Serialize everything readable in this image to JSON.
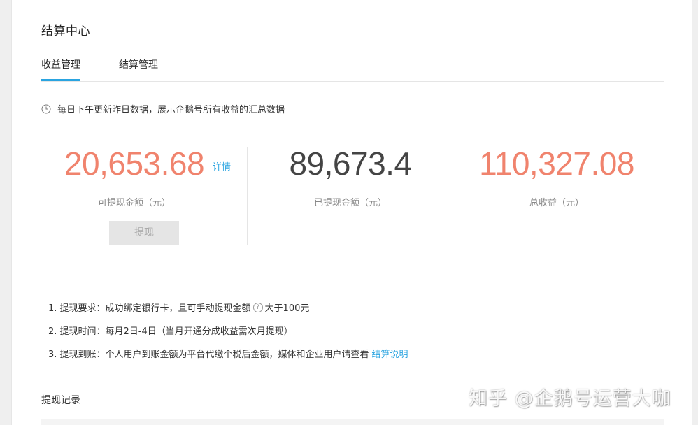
{
  "page_title": "结算中心",
  "tabs": [
    {
      "label": "收益管理",
      "active": true
    },
    {
      "label": "结算管理",
      "active": false
    }
  ],
  "notice": "每日下午更新昨日数据，展示企鹅号所有收益的汇总数据",
  "stats": {
    "withdrawable": {
      "value": "20,653.68",
      "label": "可提现金额（元）",
      "detail_link": "详情"
    },
    "withdrawn": {
      "value": "89,673.4",
      "label": "已提现金额（元）"
    },
    "total": {
      "value": "110,327.08",
      "label": "总收益（元）"
    }
  },
  "withdraw_button": "提现",
  "rules": {
    "r1_prefix": "1. 提现要求：成功绑定银行卡，且可手动提现金额",
    "r1_help": "?",
    "r1_suffix": "大于100元",
    "r2": "2. 提现时间：每月2日-4日（当月开通分成收益需次月提现）",
    "r3_text": "3. 提现到账：个人用户到账金额为平台代缴个税后金额，媒体和企业用户请查看",
    "r3_link": "结算说明"
  },
  "records_title": "提现记录",
  "watermark": "知乎 @企鹅号运营大咖",
  "colors": {
    "accent": "#2aa4e0",
    "amount": "#f0836d",
    "neutral_amount": "#444444"
  }
}
